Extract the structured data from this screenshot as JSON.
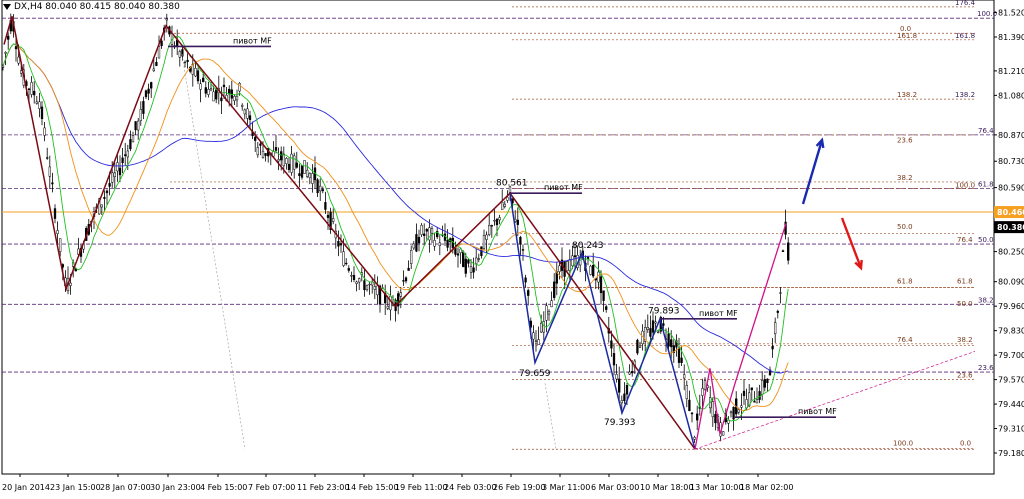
{
  "title": "DX,H4  80.040 80.415 80.040 80.380",
  "chart_data": {
    "type": "candlestick",
    "symbol": "DX",
    "timeframe": "H4",
    "ohlc_header": {
      "open": 80.04,
      "high": 80.415,
      "low": 80.04,
      "close": 80.38
    },
    "y_ticks": [
      "81.520",
      "81.390",
      "81.210",
      "81.080",
      "80.870",
      "80.730",
      "80.590",
      "80.460",
      "80.380",
      "80.250",
      "80.090",
      "79.960",
      "79.830",
      "79.700",
      "79.570",
      "79.440",
      "79.310",
      "79.180"
    ],
    "price_labels": [
      {
        "text": "80.460",
        "value": 80.46,
        "color": "#f5a020"
      },
      {
        "text": "80.380",
        "value": 80.38,
        "color": "#000000"
      }
    ],
    "x_labels": [
      "20 Jan 2014",
      "23 Jan 15:00",
      "28 Jan 07:00",
      "30 Jan 23:00",
      "4 Feb 15:00",
      "7 Feb 07:00",
      "11 Feb 23:00",
      "14 Feb 15:00",
      "19 Feb 11:00",
      "24 Feb 03:00",
      "26 Feb 19:00",
      "3 Mar 11:00",
      "6 Mar 03:00",
      "10 Mar 18:00",
      "13 Mar 10:00",
      "18 Mar 02:00"
    ],
    "price_points": [
      {
        "text": "80.561",
        "value": 80.561
      },
      {
        "text": "80.243",
        "value": 80.243
      },
      {
        "text": "79.893",
        "value": 79.893
      },
      {
        "text": "79.659",
        "value": 79.659
      },
      {
        "text": "79.393",
        "value": 79.393
      }
    ],
    "pivot_label": "пивот MF",
    "fib_labels_right_purple": [
      "176.4",
      "100.0",
      "161.8",
      "138.2",
      "76.4",
      "61.8",
      "50.0",
      "38.2",
      "23.6"
    ],
    "fib_labels_mid": [
      "0.0",
      "161.8",
      "138.2",
      "23.6",
      "38.2",
      "100.0",
      "50.0",
      "76.4",
      "61.8",
      "50.0",
      "76.4",
      "38.2",
      "23.6",
      "100.0",
      "0.0"
    ],
    "fib_labels_right": [
      "100.0",
      "76.4",
      "61.8",
      "38.2",
      "23.6",
      "0.0"
    ],
    "colors": {
      "zigzag_dark": "#7a0a14",
      "zigzag_blue": "#1a2aa0",
      "zigzag_pink": "#d0108a",
      "ma_fast": "#22c022",
      "ma_mid": "#f09018",
      "ma_slow": "#2a2ae0",
      "arrow_up": "#1a2ab0",
      "arrow_down": "#e01818",
      "current_price_line": "#f5a020",
      "fib_line": "#a0522d",
      "purple_line": "#5a2a7a"
    }
  }
}
